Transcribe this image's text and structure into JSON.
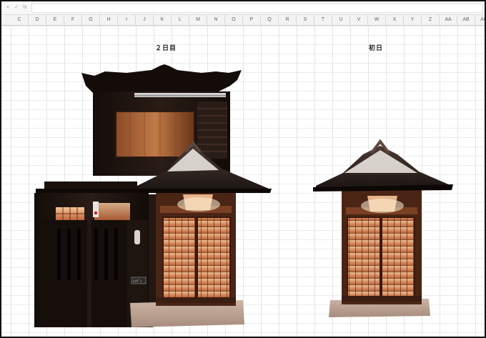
{
  "formula_bar": {
    "cancel_icon": "×",
    "confirm_icon": "✓",
    "fx_icon": "fx",
    "value": ""
  },
  "columns": [
    "C",
    "D",
    "E",
    "F",
    "G",
    "H",
    "I",
    "J",
    "K",
    "L",
    "M",
    "N",
    "O",
    "P",
    "Q",
    "R",
    "S",
    "T",
    "U",
    "V",
    "W",
    "X",
    "Y",
    "Z",
    "AA",
    "AB",
    "AC"
  ],
  "labels": {
    "left": "２日目",
    "right": "初日"
  },
  "sign_text": "ﾊﾝﾃﾞﾝ"
}
